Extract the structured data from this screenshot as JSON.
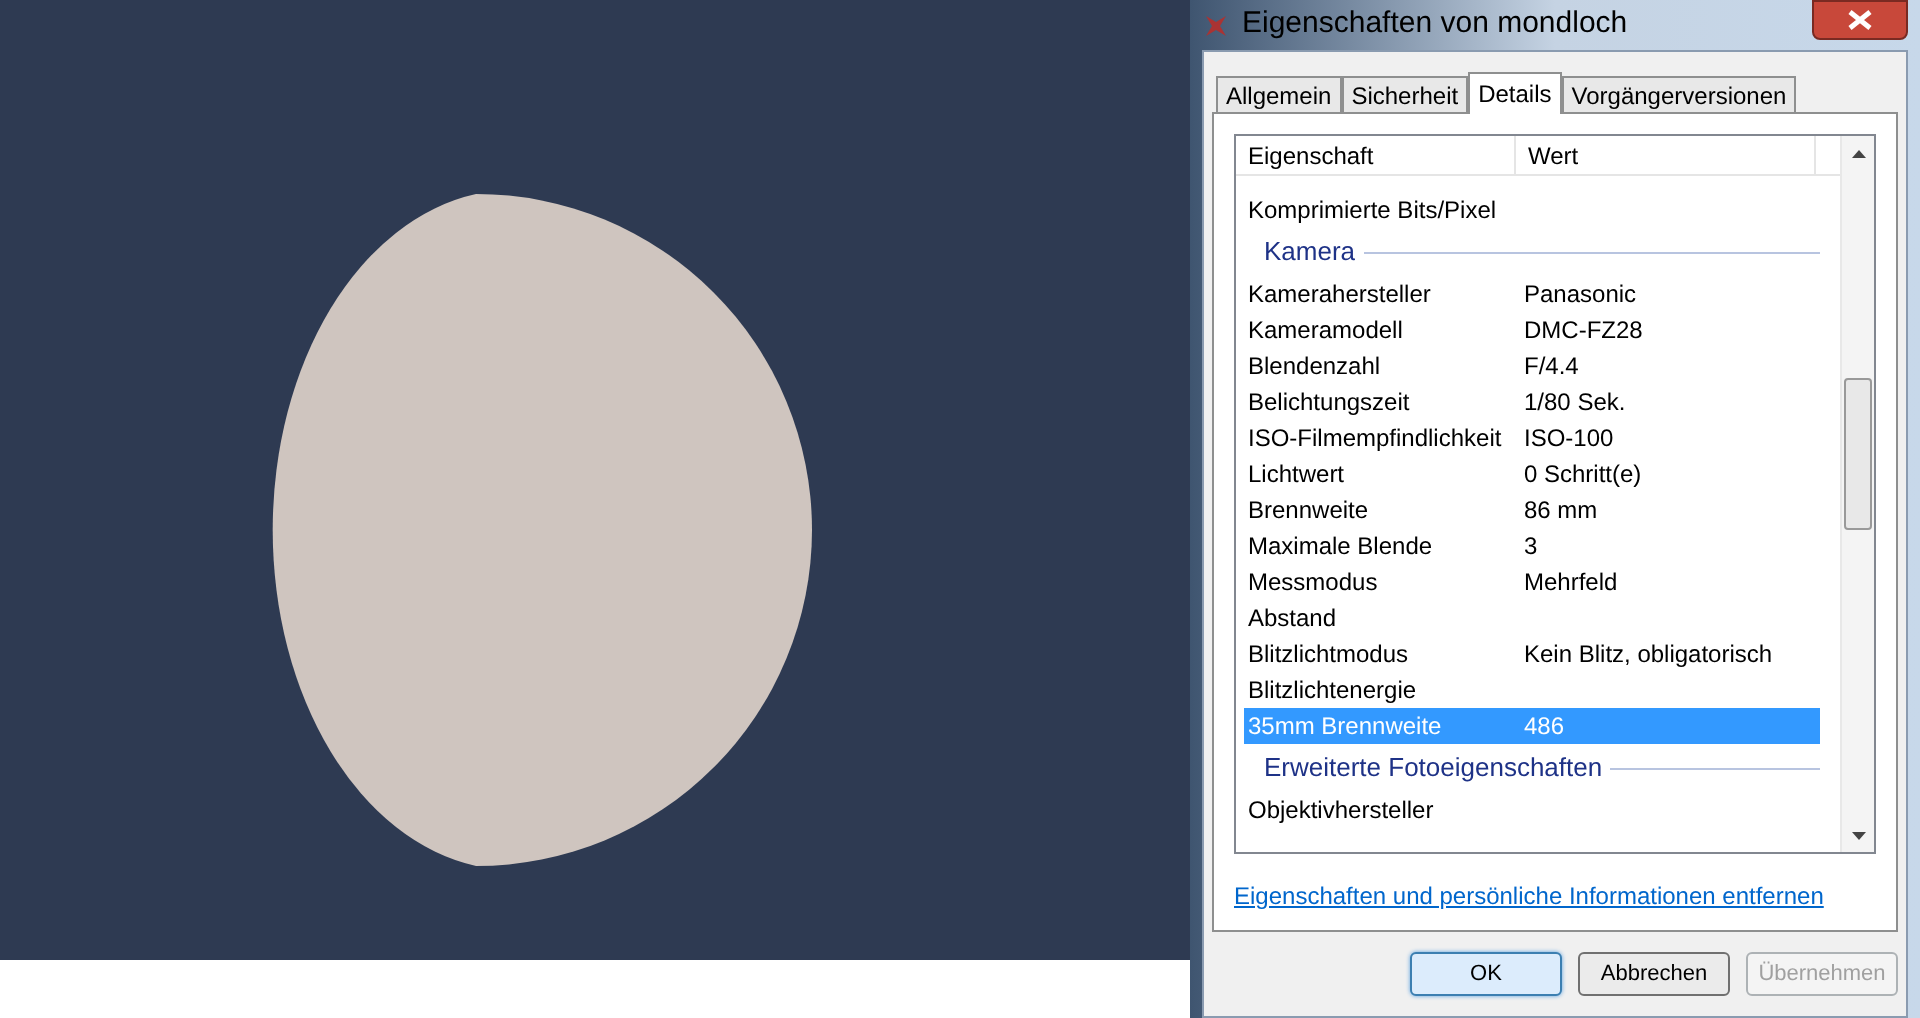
{
  "window": {
    "title": "Eigenschaften von mondloch"
  },
  "tabs": [
    {
      "label": "Allgemein",
      "selected": false
    },
    {
      "label": "Sicherheit",
      "selected": false
    },
    {
      "label": "Details",
      "selected": true
    },
    {
      "label": "Vorgängerversionen",
      "selected": false
    }
  ],
  "list": {
    "columns": [
      "Eigenschaft",
      "Wert"
    ],
    "rows": [
      {
        "kind": "property",
        "name": "Komprimierte Bits/Pixel",
        "selected": false
      },
      {
        "kind": "group",
        "name": "Kamera"
      },
      {
        "kind": "property",
        "name": "Kamerahersteller",
        "value": "Panasonic",
        "selected": false
      },
      {
        "kind": "property",
        "name": "Kameramodell",
        "value": "DMC-FZ28",
        "selected": false
      },
      {
        "kind": "property",
        "name": "Blendenzahl",
        "value": "F/4.4",
        "selected": false
      },
      {
        "kind": "property",
        "name": "Belichtungszeit",
        "value": "1/80 Sek.",
        "selected": false
      },
      {
        "kind": "property",
        "name": "ISO-Filmempfindlichkeit",
        "value": "ISO-100",
        "selected": false
      },
      {
        "kind": "property",
        "name": "Lichtwert",
        "value": "0 Schritt(e)",
        "selected": false
      },
      {
        "kind": "property",
        "name": "Brennweite",
        "value": "86 mm",
        "selected": false
      },
      {
        "kind": "property",
        "name": "Maximale Blende",
        "value": "3",
        "selected": false
      },
      {
        "kind": "property",
        "name": "Messmodus",
        "value": "Mehrfeld",
        "selected": false
      },
      {
        "kind": "property",
        "name": "Abstand",
        "selected": false
      },
      {
        "kind": "property",
        "name": "Blitzlichtmodus",
        "value": "Kein Blitz, obligatorisch",
        "selected": false
      },
      {
        "kind": "property",
        "name": "Blitzlichtenergie",
        "selected": false
      },
      {
        "kind": "property",
        "name": "35mm Brennweite",
        "value": "486",
        "selected": true
      },
      {
        "kind": "group",
        "name": "Erweiterte Fotoeigenschaften"
      },
      {
        "kind": "property",
        "name": "Objektivhersteller",
        "selected": false
      }
    ]
  },
  "link": "Eigenschaften und persönliche Informationen entfernen",
  "buttons": [
    {
      "label": "OK",
      "disabled": false,
      "default": true
    },
    {
      "label": "Abbrechen",
      "disabled": false,
      "default": false
    },
    {
      "label": "Übernehmen",
      "disabled": true,
      "default": false
    }
  ]
}
